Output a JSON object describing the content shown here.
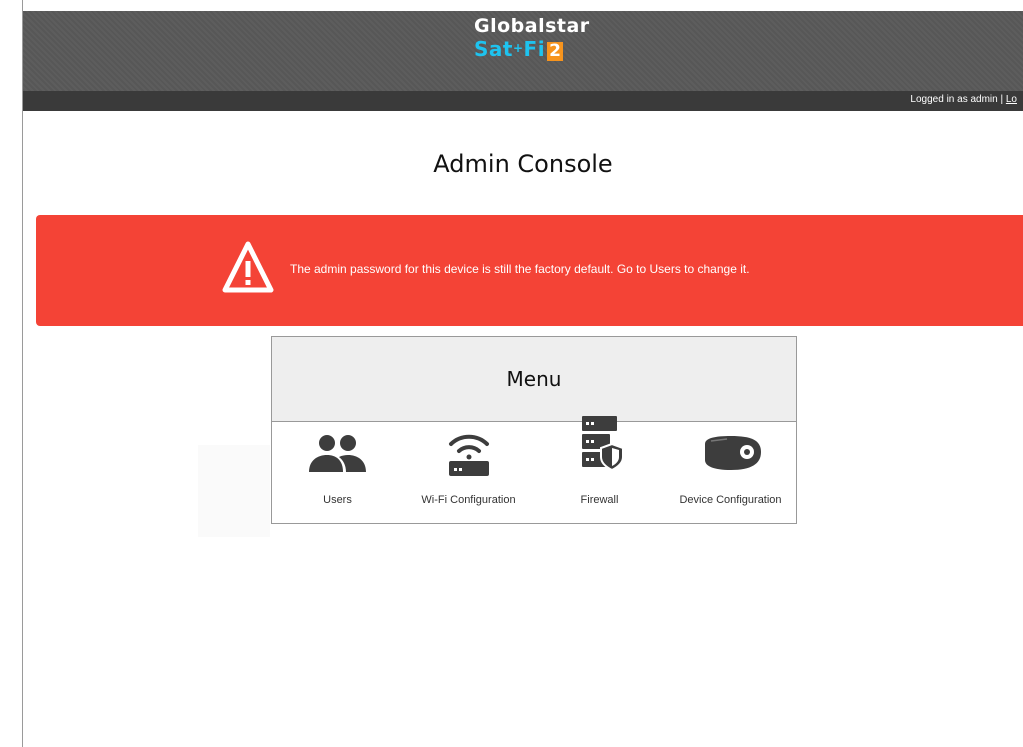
{
  "brand": {
    "line1": "Globalstar",
    "line2_main": "Sat",
    "line2_plus": "+",
    "line2_fi": "Fi",
    "line2_badge": "2",
    "colors": {
      "accent_blue": "#1ec3ef",
      "accent_orange": "#f7941d"
    }
  },
  "header": {
    "login_status": "Logged in as admin | ",
    "logout_link": "Lo"
  },
  "page": {
    "title": "Admin Console"
  },
  "alert": {
    "icon": "warning-triangle-icon",
    "message": "The admin password for this device is still the factory default. Go to Users to change it.",
    "color": "#f44336"
  },
  "menu": {
    "title": "Menu",
    "items": [
      {
        "label": "Users",
        "icon": "users-icon"
      },
      {
        "label": "Wi-Fi Configuration",
        "icon": "wifi-router-icon"
      },
      {
        "label": "Firewall",
        "icon": "firewall-server-icon"
      },
      {
        "label": "Device Configuration",
        "icon": "device-icon"
      }
    ]
  }
}
